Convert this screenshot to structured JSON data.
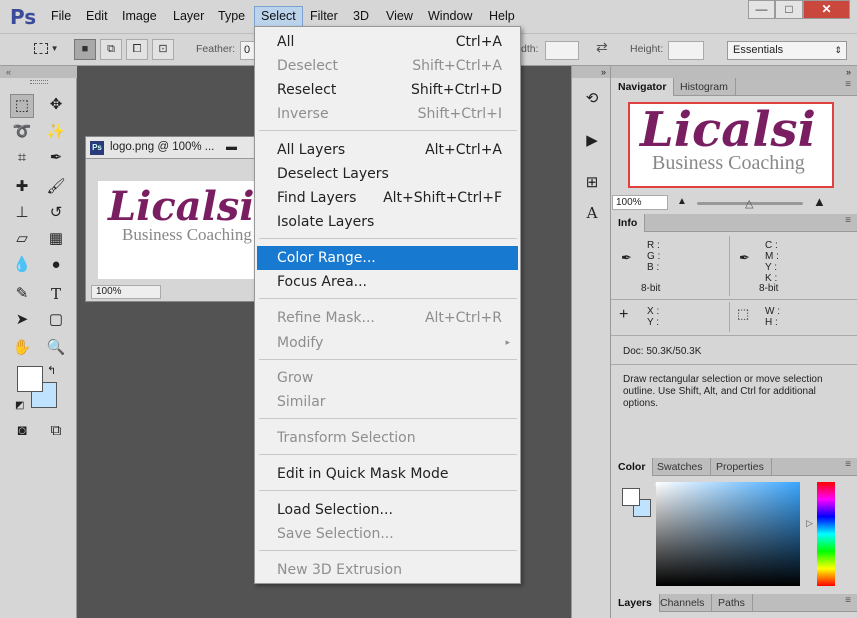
{
  "app": {
    "logo": "Ps"
  },
  "menubar": {
    "items": [
      "File",
      "Edit",
      "Image",
      "Layer",
      "Type",
      "Select",
      "Filter",
      "3D",
      "View",
      "Window",
      "Help"
    ],
    "active": "Select"
  },
  "window_controls": {
    "minimize": "—",
    "maximize": "□",
    "close": "✕"
  },
  "options_bar": {
    "feather_label": "Feather:",
    "feather_value": "0",
    "width_label": "dth:",
    "height_label": "Height:",
    "workspace": "Essentials"
  },
  "document": {
    "tab_title": "logo.png @ 100% ...",
    "zoom": "100%",
    "logo_main": "Licalsi",
    "logo_sub": "Business Coaching"
  },
  "select_menu": {
    "items": [
      {
        "label": "All",
        "shortcut": "Ctrl+A",
        "enabled": true
      },
      {
        "label": "Deselect",
        "shortcut": "Shift+Ctrl+A",
        "enabled": false
      },
      {
        "label": "Reselect",
        "shortcut": "Shift+Ctrl+D",
        "enabled": true
      },
      {
        "label": "Inverse",
        "shortcut": "Shift+Ctrl+I",
        "enabled": false
      },
      {
        "label": "All Layers",
        "shortcut": "Alt+Ctrl+A",
        "enabled": true
      },
      {
        "label": "Deselect Layers",
        "shortcut": "",
        "enabled": true
      },
      {
        "label": "Find Layers",
        "shortcut": "Alt+Shift+Ctrl+F",
        "enabled": true
      },
      {
        "label": "Isolate Layers",
        "shortcut": "",
        "enabled": true
      },
      {
        "label": "Color Range...",
        "shortcut": "",
        "enabled": true,
        "highlighted": true
      },
      {
        "label": "Focus Area...",
        "shortcut": "",
        "enabled": true
      },
      {
        "label": "Refine Mask...",
        "shortcut": "Alt+Ctrl+R",
        "enabled": false
      },
      {
        "label": "Modify",
        "shortcut": "",
        "enabled": false,
        "submenu": true
      },
      {
        "label": "Grow",
        "shortcut": "",
        "enabled": false
      },
      {
        "label": "Similar",
        "shortcut": "",
        "enabled": false
      },
      {
        "label": "Transform Selection",
        "shortcut": "",
        "enabled": false
      },
      {
        "label": "Edit in Quick Mask Mode",
        "shortcut": "",
        "enabled": true
      },
      {
        "label": "Load Selection...",
        "shortcut": "",
        "enabled": true
      },
      {
        "label": "Save Selection...",
        "shortcut": "",
        "enabled": false
      },
      {
        "label": "New 3D Extrusion",
        "shortcut": "",
        "enabled": false
      }
    ]
  },
  "navigator": {
    "tabs": [
      "Navigator",
      "Histogram"
    ],
    "zoom": "100%"
  },
  "info": {
    "tab": "Info",
    "rgb_labels": [
      "R :",
      "G :",
      "B :"
    ],
    "cmyk_labels": [
      "C :",
      "M :",
      "Y :",
      "K :"
    ],
    "bit_left": "8-bit",
    "bit_right": "8-bit",
    "xy_labels": [
      "X :",
      "Y :"
    ],
    "wh_labels": [
      "W :",
      "H :"
    ],
    "doc_size": "Doc: 50.3K/50.3K",
    "hint": "Draw rectangular selection or move selection outline.  Use Shift, Alt, and Ctrl for additional options."
  },
  "color_panel": {
    "tabs": [
      "Color",
      "Swatches",
      "Properties"
    ]
  },
  "layers_panel": {
    "tabs": [
      "Layers",
      "Channels",
      "Paths"
    ]
  },
  "colors": {
    "menu_highlight": "#1879d0",
    "logo_purple": "#7a1e62",
    "background_swatch": "#bfe3ff"
  }
}
